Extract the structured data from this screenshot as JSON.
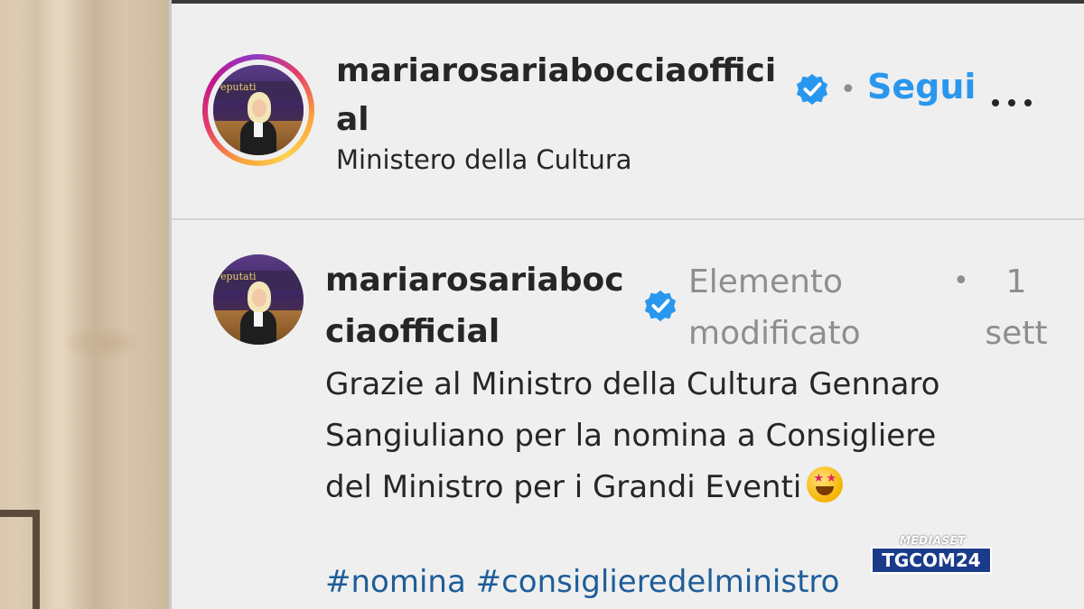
{
  "header": {
    "username": "mariarosariabocciaofficial",
    "separator": "•",
    "follow_label": "Segui",
    "location": "Ministero della Cultura",
    "more_icon": "more-horizontal-icon"
  },
  "post": {
    "username": "mariarosariaboccia­official",
    "edited_label": "Elemento modificato",
    "separator": "•",
    "time": "1 sett",
    "caption_lines": [
      "Grazie al Ministro della Cultura Gennaro",
      "Sangiuliano per la nomina a Consigliere",
      "del Ministro per i Grandi Eventi"
    ],
    "emoji": "star-struck-emoji",
    "hashtags": [
      "#nomina",
      "#consigliere­delministro"
    ]
  },
  "avatar_banner_text": "eputati",
  "broadcaster": {
    "network": "MEDIASET",
    "brand": "TGCOM24"
  },
  "colors": {
    "link_blue": "#2a97ee",
    "hashtag_blue": "#1e5d99",
    "muted_gray": "#8e8e8e",
    "text_dark": "#262626"
  }
}
